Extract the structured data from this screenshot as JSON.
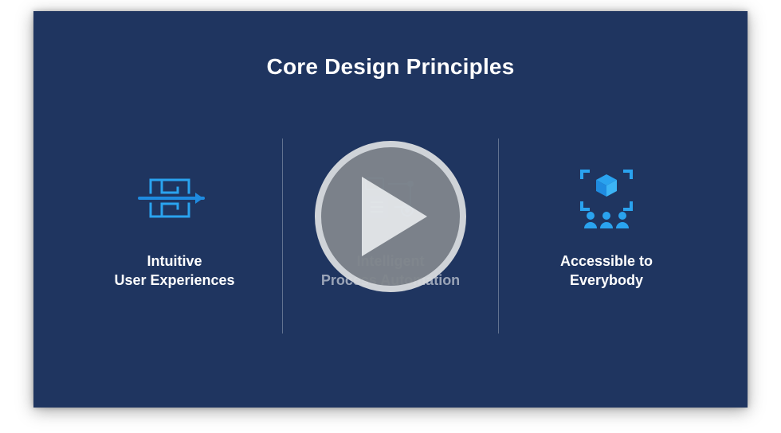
{
  "title": "Core Design Principles",
  "columns": [
    {
      "label": "Intuitive\nUser Experiences",
      "icon": "maze-arrow-icon"
    },
    {
      "label": "Intelligent\nProcess Automation",
      "icon": "automation-icon"
    },
    {
      "label": "Accessible to\nEverybody",
      "icon": "people-cube-icon"
    }
  ],
  "overlay": {
    "play": true
  },
  "colors": {
    "background": "#1f3560",
    "accent": "#2aa3ef"
  }
}
